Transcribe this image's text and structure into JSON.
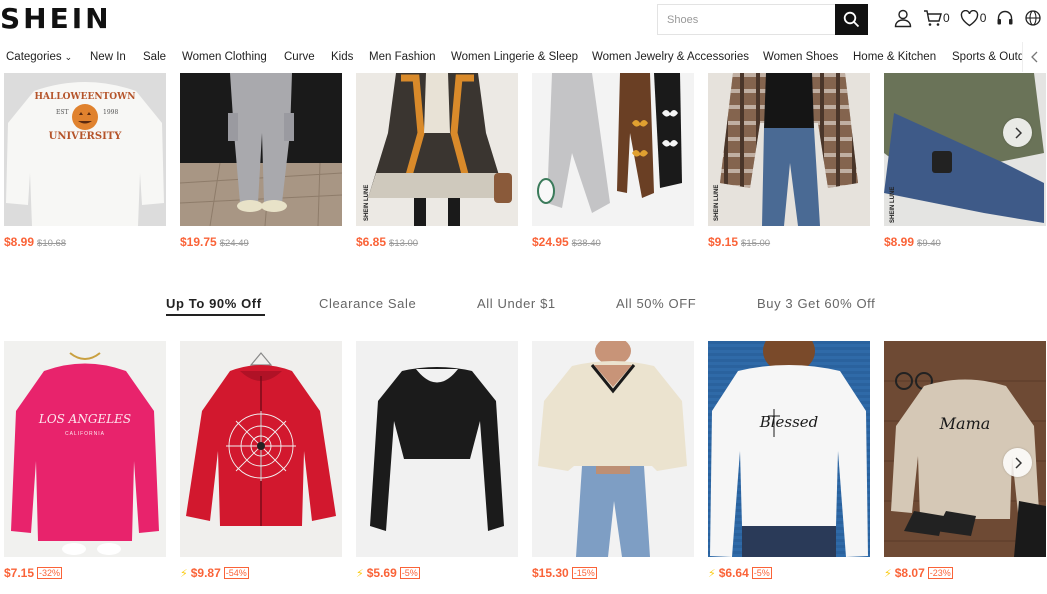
{
  "brand": "SHEIN",
  "search": {
    "placeholder": "Shoes"
  },
  "header_icons": [
    {
      "icon": "user-icon",
      "count": ""
    },
    {
      "icon": "cart-icon",
      "count": "0"
    },
    {
      "icon": "heart-icon",
      "count": "0"
    },
    {
      "icon": "headset-icon",
      "count": ""
    },
    {
      "icon": "globe-icon",
      "count": ""
    }
  ],
  "nav": {
    "items": [
      "Categories",
      "New In",
      "Sale",
      "Women Clothing",
      "Curve",
      "Kids",
      "Men Fashion",
      "Women Lingerie & Sleep",
      "Women Jewelry & Accessories",
      "Women Shoes",
      "Home & Kitchen",
      "Sports & Outd"
    ]
  },
  "row1": [
    {
      "name": "Halloweentown University sweatshirt",
      "price": "$8.99",
      "old": "$10.68"
    },
    {
      "name": "Grey cargo pants",
      "price": "$19.75",
      "old": "$24.49"
    },
    {
      "name": "Patterned dress",
      "price": "$6.85",
      "old": "$13.00"
    },
    {
      "name": "Butterfly sweatpants",
      "price": "$24.95",
      "old": "$38.40"
    },
    {
      "name": "Plaid shacket",
      "price": "$9.15",
      "old": "$15.00"
    },
    {
      "name": "Olive sweater",
      "price": "$8.99",
      "old": "$9.40"
    }
  ],
  "tabs": [
    "Up To 90% Off",
    "Clearance Sale",
    "All Under $1",
    "All 50% OFF",
    "Buy 3 Get 60% Off"
  ],
  "row2": [
    {
      "name": "Los Angeles sweatshirt",
      "price": "$7.15",
      "discount": "-32%",
      "flash": false
    },
    {
      "name": "Spider web hoodie",
      "price": "$9.87",
      "discount": "-54%",
      "flash": true
    },
    {
      "name": "Black crop top",
      "price": "$5.69",
      "discount": "-5%",
      "flash": true
    },
    {
      "name": "Cream V-neck sweater",
      "price": "$15.30",
      "discount": "-15%",
      "flash": false
    },
    {
      "name": "Blessed top",
      "price": "$6.64",
      "discount": "-5%",
      "flash": true
    },
    {
      "name": "Mama sweatshirt",
      "price": "$8.07",
      "discount": "-23%",
      "flash": true
    }
  ],
  "colors": {
    "accent": "#fa6338",
    "flash": "#facc15",
    "dark": "#111111"
  },
  "img_text": {
    "halloween": "HALLOWEENTOWN",
    "est": "EST",
    "year": "1998",
    "university": "UNIVERSITY",
    "losangeles": "LOS ANGELES",
    "california": "CALIFORNIA",
    "blessed": "Blessed",
    "mama": "Mama",
    "sheinlune": "SHEIN LUNE"
  }
}
